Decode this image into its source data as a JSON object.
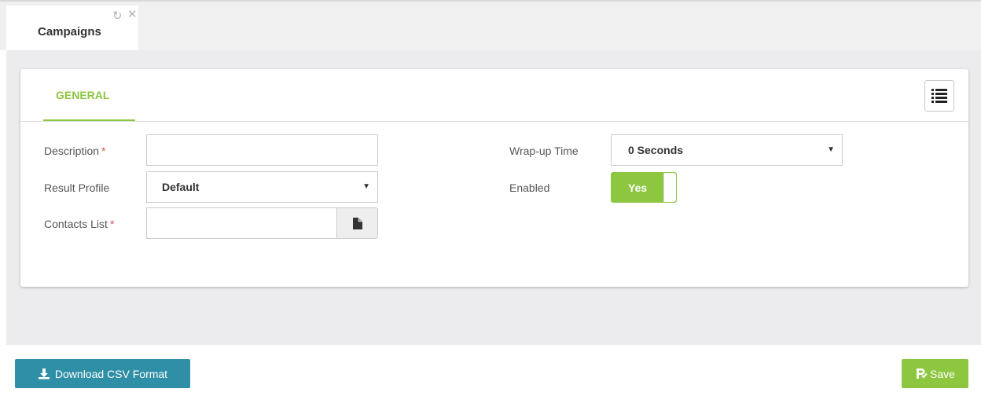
{
  "tabbar": {
    "tab_title": "Campaigns",
    "refresh_glyph": "↻",
    "close_glyph": "✕"
  },
  "card": {
    "tab_label": "GENERAL"
  },
  "form": {
    "description_label": "Description",
    "description_value": "",
    "result_profile_label": "Result Profile",
    "result_profile_value": "Default",
    "contacts_list_label": "Contacts List",
    "contacts_list_value": "",
    "required_mark": "*",
    "wrapup_label": "Wrap-up Time",
    "wrapup_value": "0 Seconds",
    "enabled_label": "Enabled",
    "enabled_value": "Yes"
  },
  "footer": {
    "csv_label": "Download CSV Format",
    "save_label": "Save"
  },
  "icons": {
    "caret": "▼",
    "list": "list-icon",
    "file": "file-icon",
    "download": "download-icon",
    "save": "save-icon"
  },
  "colors": {
    "accent_green": "#8dc63f",
    "csv_button": "#2f8fa6",
    "required": "#d9534f"
  }
}
